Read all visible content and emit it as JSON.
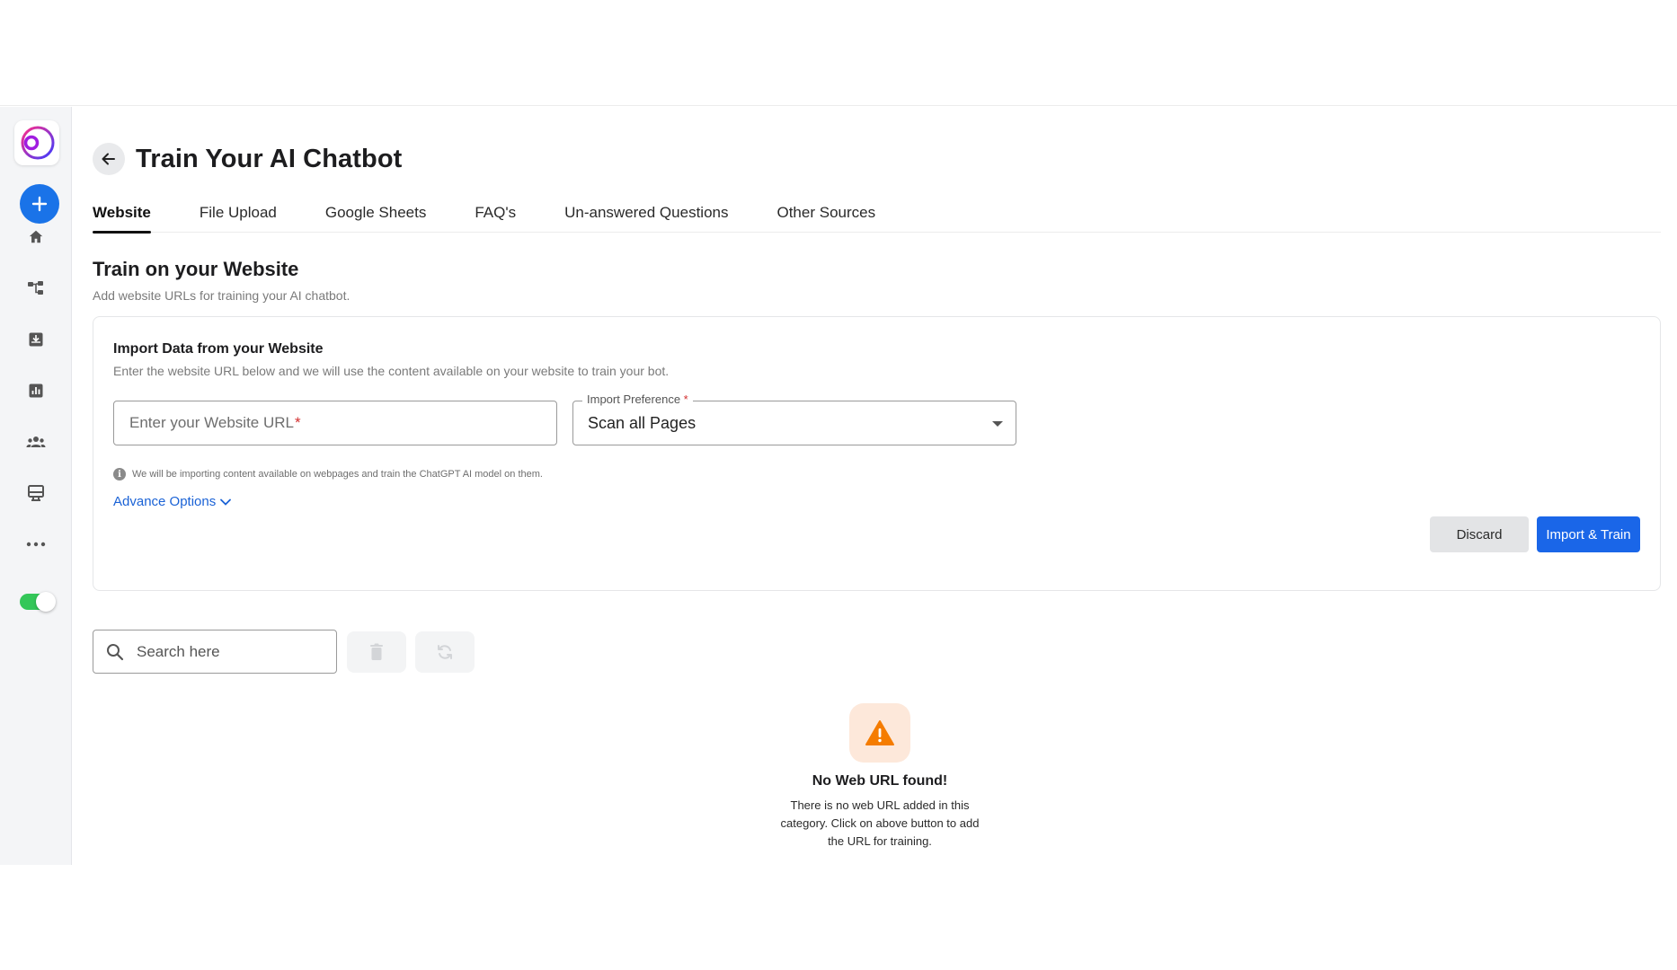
{
  "page": {
    "title": "Train Your AI Chatbot"
  },
  "tabs": [
    {
      "label": "Website"
    },
    {
      "label": "File Upload"
    },
    {
      "label": "Google Sheets"
    },
    {
      "label": "FAQ's"
    },
    {
      "label": "Un-answered Questions"
    },
    {
      "label": "Other Sources"
    }
  ],
  "section": {
    "title": "Train on your Website",
    "subtitle": "Add website URLs for training your AI chatbot."
  },
  "import_card": {
    "title": "Import Data from your Website",
    "subtitle": "Enter the website URL below and we will use the content available on your website to train your bot.",
    "url_placeholder": "Enter your Website URL",
    "required_mark": "*",
    "preference_label": "Import Preference",
    "preference_value": "Scan all Pages",
    "info_text": "We will be importing content available on webpages and train the ChatGPT AI model on them.",
    "advance_options": "Advance Options",
    "discard_label": "Discard",
    "import_label": "Import & Train"
  },
  "search": {
    "placeholder": "Search here"
  },
  "empty_state": {
    "title": "No Web URL found!",
    "text": "There is no web URL added in this category. Click on above button to add the URL for training."
  },
  "colors": {
    "accent": "#1a66e8",
    "toggle_on": "#34c759",
    "warning": "#f57c00",
    "warning_bg": "#fde8da",
    "logo_ring": "#8a2be2"
  },
  "sidebar": {
    "icons": [
      "home-icon",
      "flow-icon",
      "inbox-icon",
      "analytics-icon",
      "users-icon",
      "channels-icon",
      "more-icon"
    ],
    "toggle_on": true
  }
}
